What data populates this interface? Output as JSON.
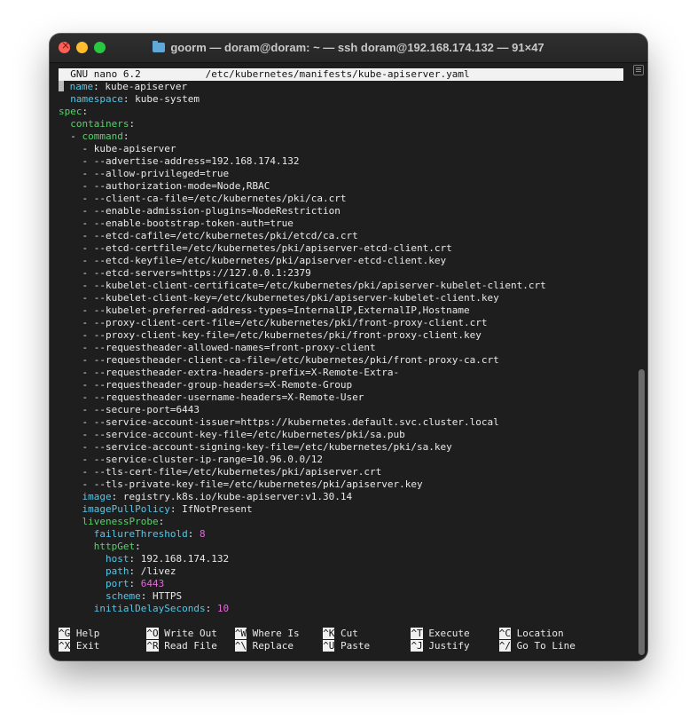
{
  "window": {
    "title": "goorm — doram@doram: ~ — ssh doram@192.168.174.132 — 91×47"
  },
  "nano": {
    "header_version": "GNU nano 6.2",
    "header_file": "/etc/kubernetes/manifests/kube-apiserver.yaml"
  },
  "yaml": {
    "name_key": "name",
    "name_val": "kube-apiserver",
    "namespace_key": "namespace",
    "namespace_val": "kube-system",
    "spec_key": "spec",
    "containers_key": "containers",
    "command_key": "command",
    "command_items": [
      "kube-apiserver",
      "--advertise-address=192.168.174.132",
      "--allow-privileged=true",
      "--authorization-mode=Node,RBAC",
      "--client-ca-file=/etc/kubernetes/pki/ca.crt",
      "--enable-admission-plugins=NodeRestriction",
      "--enable-bootstrap-token-auth=true",
      "--etcd-cafile=/etc/kubernetes/pki/etcd/ca.crt",
      "--etcd-certfile=/etc/kubernetes/pki/apiserver-etcd-client.crt",
      "--etcd-keyfile=/etc/kubernetes/pki/apiserver-etcd-client.key",
      "--etcd-servers=https://127.0.0.1:2379",
      "--kubelet-client-certificate=/etc/kubernetes/pki/apiserver-kubelet-client.crt",
      "--kubelet-client-key=/etc/kubernetes/pki/apiserver-kubelet-client.key",
      "--kubelet-preferred-address-types=InternalIP,ExternalIP,Hostname",
      "--proxy-client-cert-file=/etc/kubernetes/pki/front-proxy-client.crt",
      "--proxy-client-key-file=/etc/kubernetes/pki/front-proxy-client.key",
      "--requestheader-allowed-names=front-proxy-client",
      "--requestheader-client-ca-file=/etc/kubernetes/pki/front-proxy-ca.crt",
      "--requestheader-extra-headers-prefix=X-Remote-Extra-",
      "--requestheader-group-headers=X-Remote-Group",
      "--requestheader-username-headers=X-Remote-User",
      "--secure-port=6443",
      "--service-account-issuer=https://kubernetes.default.svc.cluster.local",
      "--service-account-key-file=/etc/kubernetes/pki/sa.pub",
      "--service-account-signing-key-file=/etc/kubernetes/pki/sa.key",
      "--service-cluster-ip-range=10.96.0.0/12",
      "--tls-cert-file=/etc/kubernetes/pki/apiserver.crt",
      "--tls-private-key-file=/etc/kubernetes/pki/apiserver.key"
    ],
    "image_key": "image",
    "image_val": "registry.k8s.io/kube-apiserver:v1.30.14",
    "pull_key": "imagePullPolicy",
    "pull_val": "IfNotPresent",
    "liveness_key": "livenessProbe",
    "failure_key": "failureThreshold",
    "failure_val": "8",
    "httpget_key": "httpGet",
    "host_key": "host",
    "host_val": "192.168.174.132",
    "path_key": "path",
    "path_val": "/livez",
    "port_key": "port",
    "port_val": "6443",
    "scheme_key": "scheme",
    "scheme_val": "HTTPS",
    "initial_key": "initialDelaySeconds",
    "initial_val": "10"
  },
  "shortcuts": [
    {
      "key": "^G",
      "label": "Help"
    },
    {
      "key": "^O",
      "label": "Write Out"
    },
    {
      "key": "^W",
      "label": "Where Is"
    },
    {
      "key": "^K",
      "label": "Cut"
    },
    {
      "key": "^T",
      "label": "Execute"
    },
    {
      "key": "^C",
      "label": "Location"
    },
    {
      "key": "^X",
      "label": "Exit"
    },
    {
      "key": "^R",
      "label": "Read File"
    },
    {
      "key": "^\\",
      "label": "Replace"
    },
    {
      "key": "^U",
      "label": "Paste"
    },
    {
      "key": "^J",
      "label": "Justify"
    },
    {
      "key": "^/",
      "label": "Go To Line"
    }
  ]
}
